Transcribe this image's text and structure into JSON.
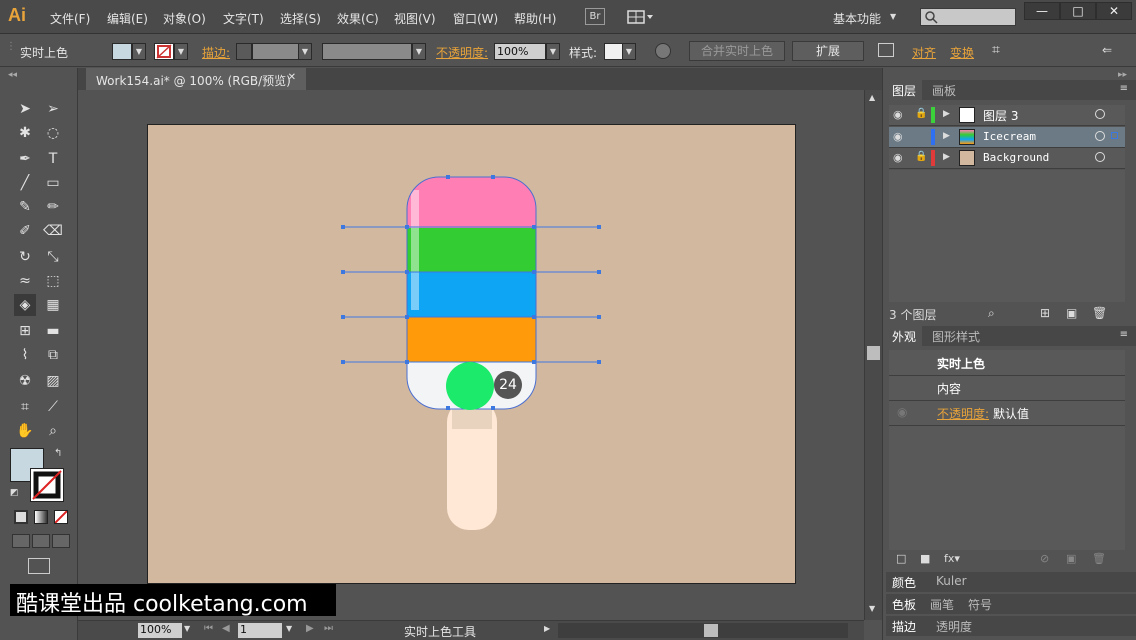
{
  "app": {
    "logo": "Ai"
  },
  "menu": {
    "items": [
      "文件(F)",
      "编辑(E)",
      "对象(O)",
      "文字(T)",
      "选择(S)",
      "效果(C)",
      "视图(V)",
      "窗口(W)",
      "帮助(H)"
    ],
    "br": "Br",
    "workspace": "基本功能",
    "win_min": "—",
    "win_max": "□",
    "win_close": "✕"
  },
  "control": {
    "tool_name": "实时上色",
    "stroke_label": "描边:",
    "opacity_label": "不透明度:",
    "opacity_value": "100%",
    "style_label": "样式:",
    "merge_button": "合并实时上色",
    "expand_button": "扩展",
    "align_link": "对齐",
    "transform_link": "变换",
    "fill_color": "#c8d8e0"
  },
  "document": {
    "tab_title": "Work154.ai* @ 100% (RGB/预览)",
    "close": "✕",
    "artboard_color": "#d3b8a0",
    "badge_number": "24"
  },
  "status": {
    "zoom": "100%",
    "page": "1",
    "tool": "实时上色工具"
  },
  "layers_panel": {
    "tab_layers": "图层",
    "tab_artboards": "画板",
    "rows": [
      {
        "name": "图层 3",
        "color": "#3ad13a"
      },
      {
        "name": "Icecream",
        "color": "#2f6ff2"
      },
      {
        "name": "Background",
        "color": "#e03a3a"
      }
    ],
    "count": "3 个图层"
  },
  "appearance_panel": {
    "tab_appearance": "外观",
    "tab_styles": "图形样式",
    "title": "实时上色",
    "content": "内容",
    "opacity_label": "不透明度:",
    "opacity_value": "默认值"
  },
  "bottom_tabs": {
    "color": "颜色",
    "kuler": "Kuler",
    "swatches": "色板",
    "brushes": "画笔",
    "symbols": "符号",
    "stroke": "描边",
    "transparency": "透明度"
  },
  "watermark": "酷课堂出品 coolketang.com",
  "colors": {
    "pink": "#ff7fb4",
    "green": "#33cc33",
    "blue": "#0ea5f5",
    "orange": "#ff9a0a",
    "white": "#f2f4f6",
    "green_circle": "#1bea6a",
    "stick": "#ffe8d6"
  }
}
